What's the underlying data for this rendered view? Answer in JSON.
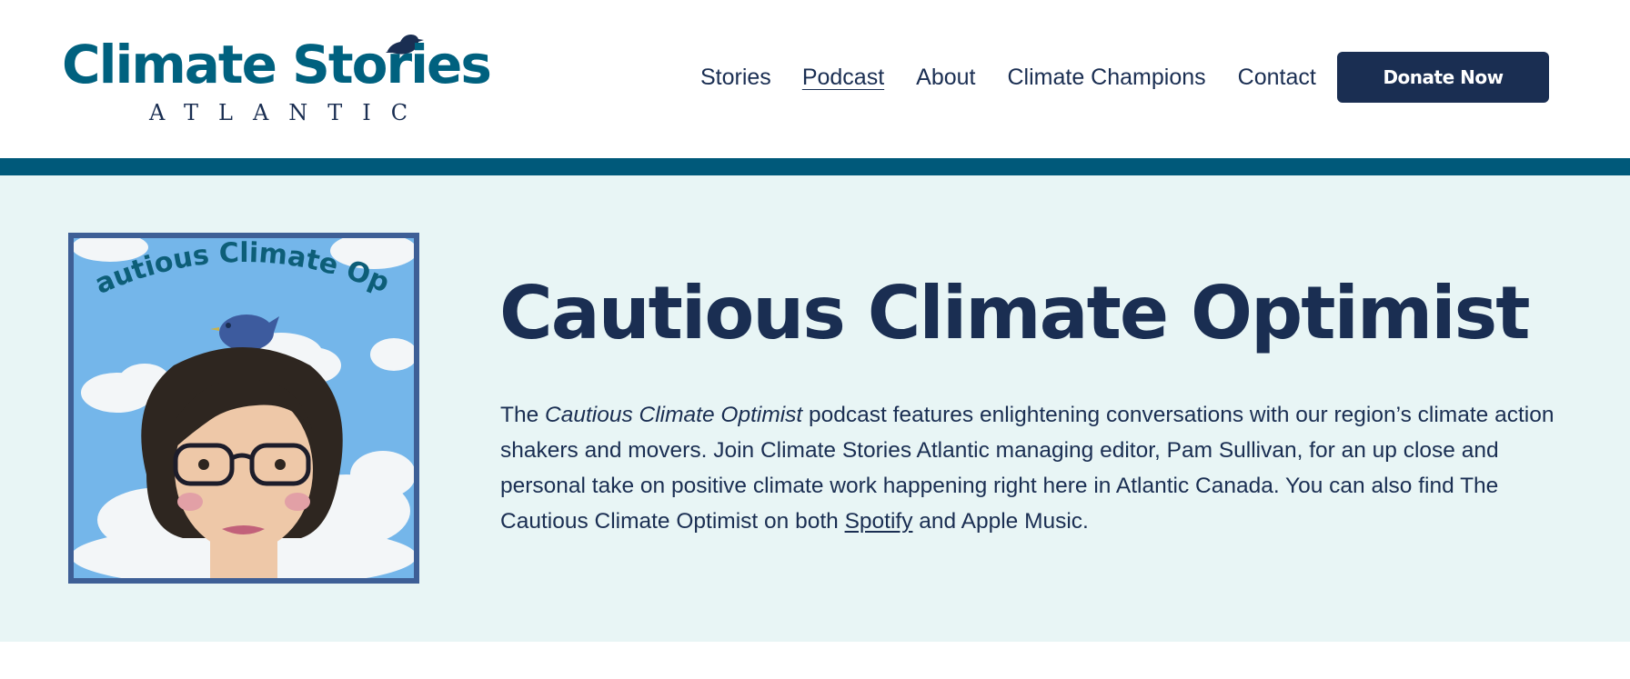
{
  "logo": {
    "title": "Climate Stories",
    "subtitle": "ATLANTIC"
  },
  "nav": {
    "items": [
      {
        "label": "Stories",
        "active": false
      },
      {
        "label": "Podcast",
        "active": true
      },
      {
        "label": "About",
        "active": false
      },
      {
        "label": "Climate Champions",
        "active": false
      },
      {
        "label": "Contact",
        "active": false
      }
    ],
    "donate_label": "Donate Now"
  },
  "hero": {
    "cover_title": "The Cautious Climate Optimist",
    "title": "Cautious Climate Optimist",
    "intro_before": "The ",
    "intro_em": "Cautious Climate Optimist",
    "intro_after": " podcast features enlightening conversations with our region’s climate action shakers and movers. Join Climate Stories Atlantic managing editor, Pam Sullivan, for an up close and personal take on positive climate work happening right here in Atlantic Canada. You can also find The Cautious Climate Optimist on both ",
    "link_spotify": "Spotify",
    "intro_end": " and Apple Music."
  },
  "colors": {
    "brand_teal": "#00617f",
    "navy": "#1a2e52",
    "band": "#00597a",
    "hero_bg": "#e8f5f5"
  },
  "icons": [
    "bird-icon"
  ]
}
